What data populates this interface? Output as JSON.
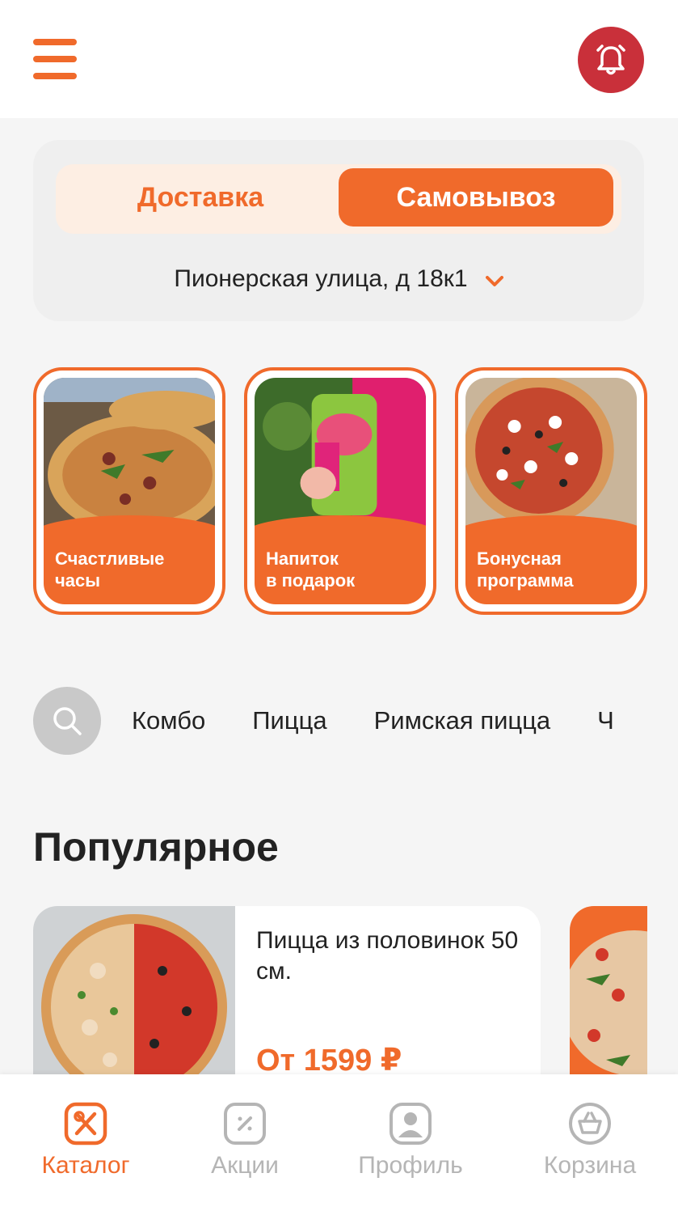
{
  "colors": {
    "accent": "#f06a2b",
    "bell": "#c9303a",
    "inactive": "#b5b5b5"
  },
  "header": {
    "menu_icon": "hamburger-menu-icon",
    "bell_icon": "bell-icon"
  },
  "order_mode": {
    "delivery_label": "Доставка",
    "pickup_label": "Самовывоз",
    "selected": "pickup",
    "address": "Пионерская улица, д 18к1"
  },
  "promos": [
    {
      "label": "Счастливые\nчасы"
    },
    {
      "label": "Напиток\nв подарок"
    },
    {
      "label": "Бонусная\nпрограмма"
    }
  ],
  "categories": [
    "Комбо",
    "Пицца",
    "Римская пицца",
    "Ч"
  ],
  "popular": {
    "title": "Популярное",
    "items": [
      {
        "name": "Пицца из половинок 50 см.",
        "price": "От 1599 ₽"
      }
    ]
  },
  "tabs": [
    {
      "label": "Каталог",
      "icon": "catalog-icon",
      "active": true
    },
    {
      "label": "Акции",
      "icon": "discount-icon",
      "active": false
    },
    {
      "label": "Профиль",
      "icon": "profile-icon",
      "active": false
    },
    {
      "label": "Корзина",
      "icon": "basket-icon",
      "active": false
    }
  ]
}
